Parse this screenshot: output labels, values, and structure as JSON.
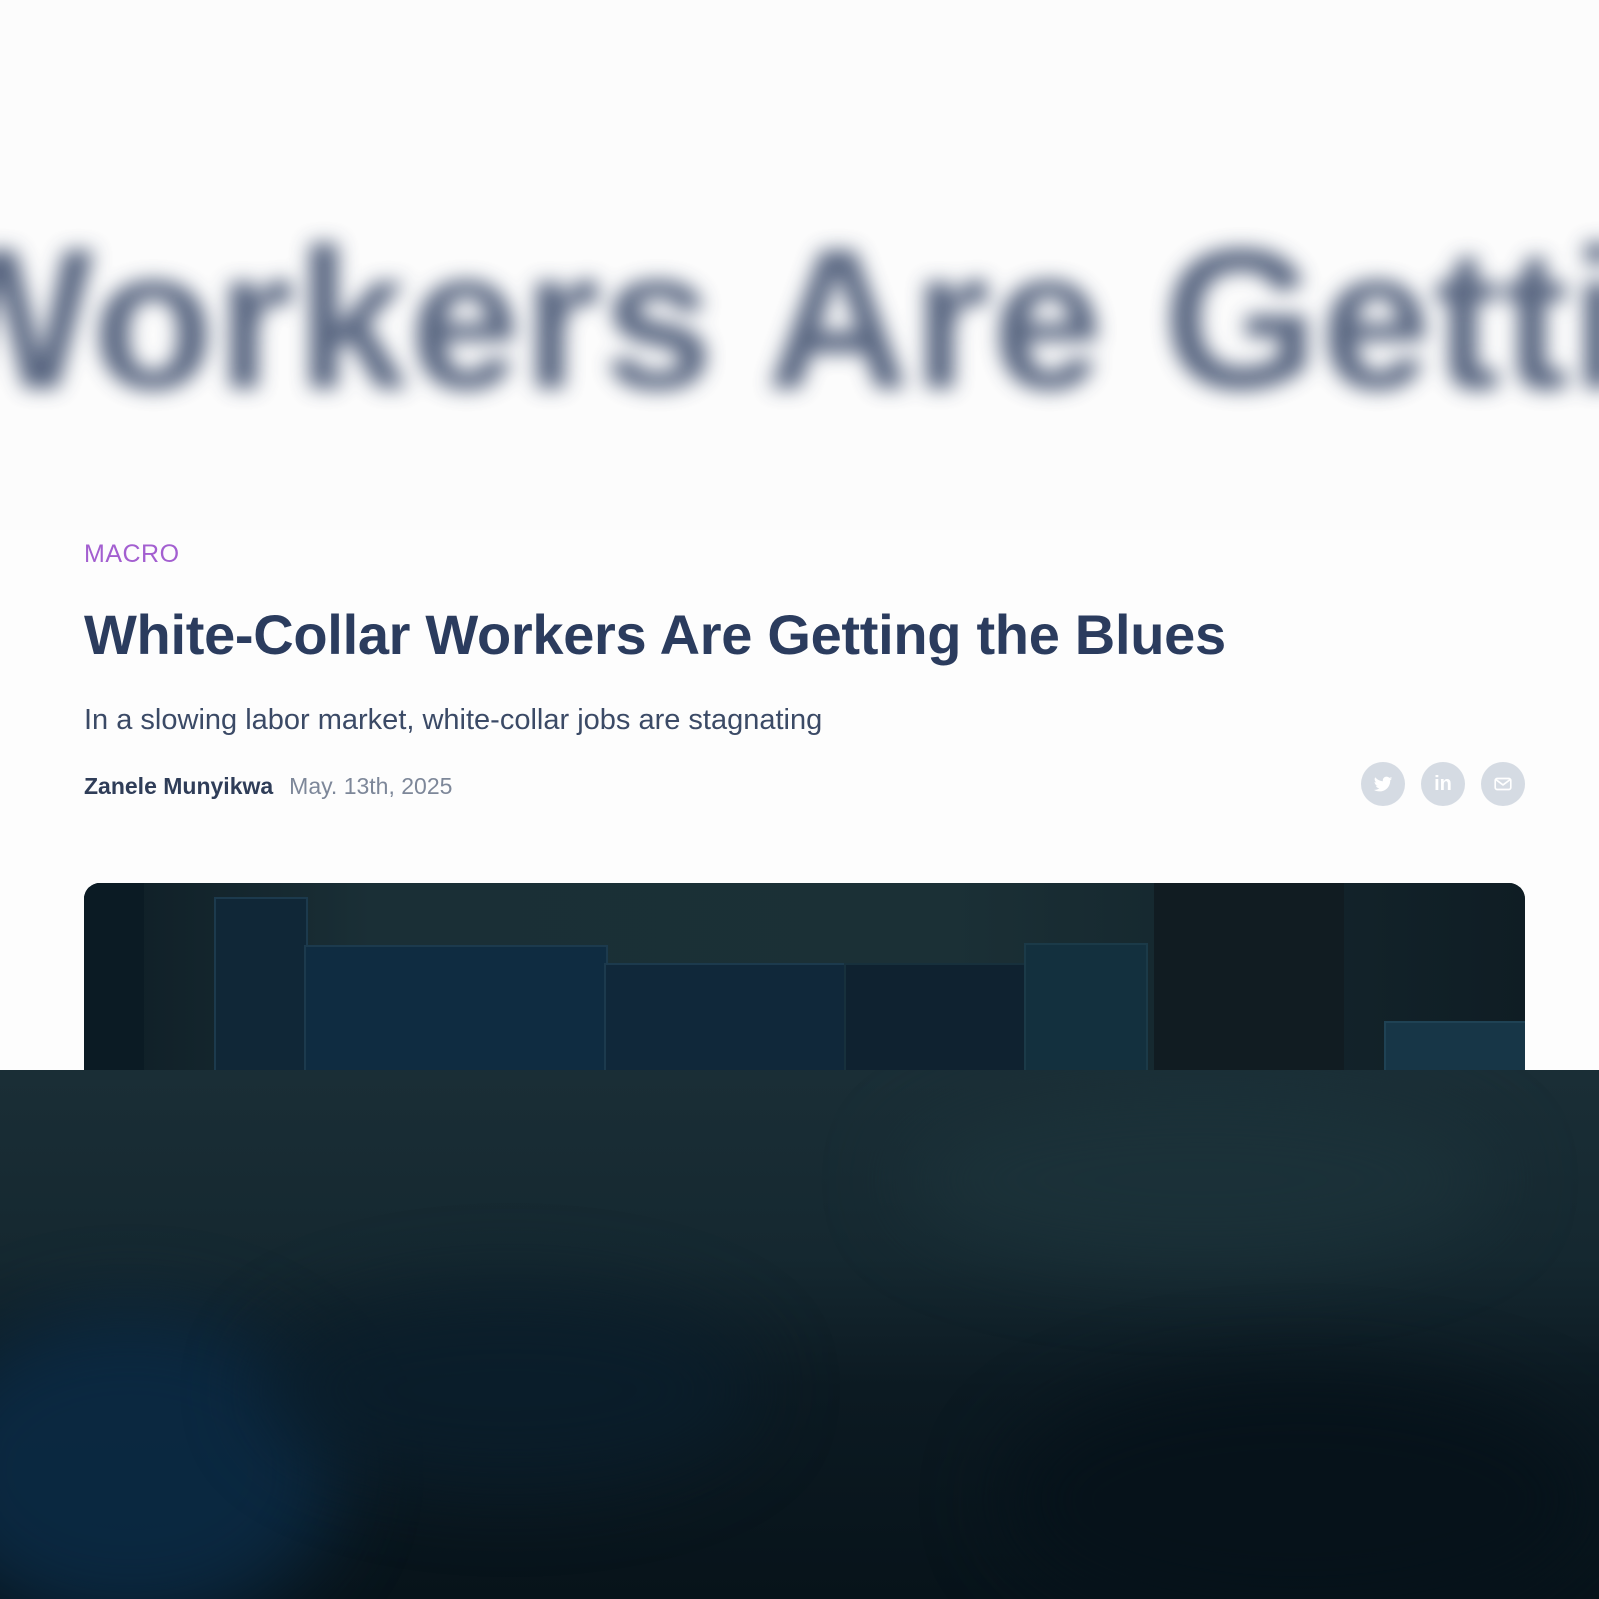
{
  "background_blur_text": "Workers Are Getting",
  "article": {
    "category": "MACRO",
    "headline": "White-Collar Workers Are Getting the Blues",
    "subheadline": "In a slowing labor market, white-collar jobs are stagnating",
    "author": "Zanele Munyikwa",
    "date": "May. 13th, 2025"
  },
  "share": {
    "twitter_icon": "twitter-icon",
    "linkedin_icon": "linkedin-icon",
    "linkedin_glyph": "in",
    "email_icon": "mail-icon"
  },
  "hero_image": {
    "description_icon": "office-cubicles-photo"
  },
  "colors": {
    "category": "#a35fd0",
    "headline": "#2b3c5e",
    "share_button_bg": "#d5dbe3",
    "hero_dark": "#13252c"
  }
}
